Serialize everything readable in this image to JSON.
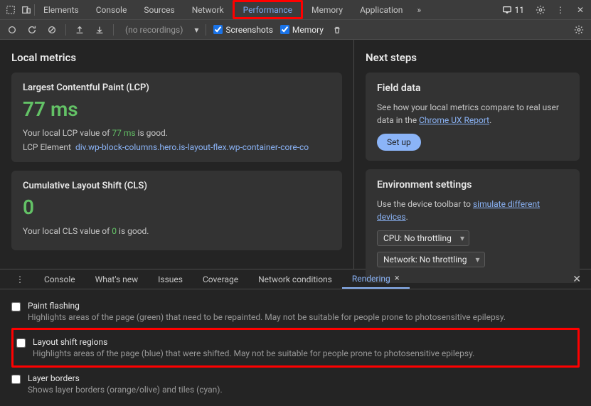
{
  "topbar": {
    "tabs": [
      "Elements",
      "Console",
      "Sources",
      "Network",
      "Performance",
      "Memory",
      "Application"
    ],
    "active_tab": "Performance",
    "error_count": "11"
  },
  "toolbar": {
    "recordings": "(no recordings)",
    "screenshots_label": "Screenshots",
    "memory_label": "Memory"
  },
  "local_metrics": {
    "heading": "Local metrics",
    "lcp": {
      "title": "Largest Contentful Paint (LCP)",
      "value": "77 ms",
      "desc_pre": "Your local LCP value of ",
      "desc_val": "77 ms",
      "desc_post": " is good.",
      "element_label": "LCP Element",
      "element_selector": "div.wp-block-columns.hero.is-layout-flex.wp-container-core-co"
    },
    "cls": {
      "title": "Cumulative Layout Shift (CLS)",
      "value": "0",
      "desc_pre": "Your local CLS value of ",
      "desc_val": "0",
      "desc_post": " is good."
    }
  },
  "next_steps": {
    "heading": "Next steps",
    "field_data": {
      "title": "Field data",
      "desc_pre": "See how your local metrics compare to real user data in the ",
      "link": "Chrome UX Report",
      "desc_post": ".",
      "button": "Set up"
    },
    "env": {
      "title": "Environment settings",
      "desc_pre": "Use the device toolbar to ",
      "link": "simulate different devices",
      "desc_post": ".",
      "cpu": "CPU: No throttling",
      "network": "Network: No throttling"
    }
  },
  "drawer": {
    "tabs": [
      "Console",
      "What's new",
      "Issues",
      "Coverage",
      "Network conditions",
      "Rendering"
    ],
    "active": "Rendering",
    "options": [
      {
        "title": "Paint flashing",
        "desc": "Highlights areas of the page (green) that need to be repainted. May not be suitable for people prone to photosensitive epilepsy."
      },
      {
        "title": "Layout shift regions",
        "desc": "Highlights areas of the page (blue) that were shifted. May not be suitable for people prone to photosensitive epilepsy."
      },
      {
        "title": "Layer borders",
        "desc": "Shows layer borders (orange/olive) and tiles (cyan)."
      }
    ]
  }
}
